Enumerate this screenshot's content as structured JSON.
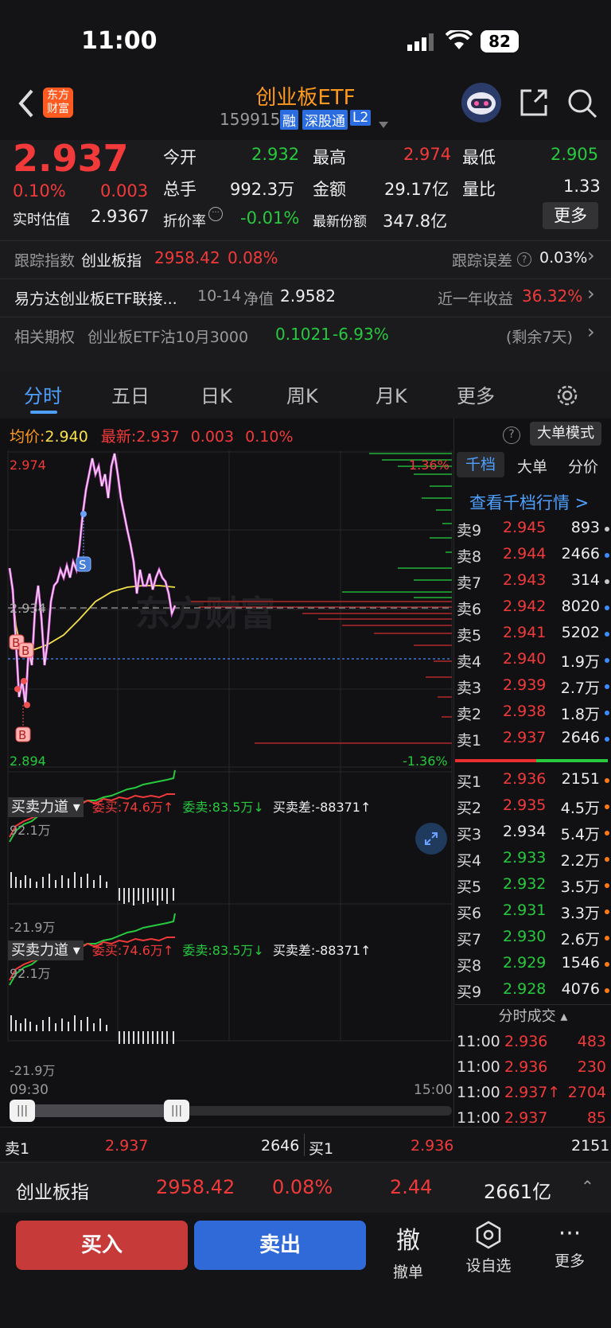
{
  "status": {
    "time": "11:00",
    "battery": "82"
  },
  "header": {
    "title": "创业板ETF",
    "code": "159915",
    "tags": [
      "融",
      "深股通",
      "L2"
    ],
    "logo_text_1": "东方",
    "logo_text_2": "财富"
  },
  "quote": {
    "price": "2.937",
    "change_pct": "0.10%",
    "change": "0.003",
    "est_label": "实时估值",
    "est_value": "2.9367",
    "open_label": "今开",
    "open": "2.932",
    "high_label": "最高",
    "high": "2.974",
    "low_label": "最低",
    "low": "2.905",
    "vol_label": "总手",
    "vol": "992.3万",
    "amount_label": "金额",
    "amount": "29.17亿",
    "ratio_label": "量比",
    "ratio": "1.33",
    "discount_label": "折价率",
    "discount": "-0.01%",
    "shares_label": "最新份额",
    "shares": "347.8亿",
    "more": "更多"
  },
  "track": {
    "label": "跟踪指数",
    "index": "创业板指",
    "value": "2958.42",
    "pct": "0.08%",
    "err_label": "跟踪误差",
    "err": "0.03%"
  },
  "fund": {
    "name": "易方达创业板ETF联接...",
    "date": "10-14",
    "nav_label": "净值",
    "nav": "2.9582",
    "ret_label": "近一年收益",
    "ret": "36.32%"
  },
  "option": {
    "label": "相关期权",
    "name": "创业板ETF沽10月3000",
    "price": "0.1021",
    "pct": "-6.93%",
    "remain": "(剩余7天)"
  },
  "tabs": [
    "分时",
    "五日",
    "日K",
    "周K",
    "月K",
    "更多"
  ],
  "chart": {
    "avg_label": "均价:",
    "avg": "2.940",
    "last_label": "最新:",
    "last": "2.937",
    "chg": "0.003",
    "pct": "0.10%",
    "big_mode": "大单模式",
    "high": "2.974",
    "low": "2.894",
    "mid": "2.934",
    "up_pct": "1.36%",
    "down_pct": "-1.36%",
    "time_start": "09:30",
    "time_end": "15:00",
    "watermark": "东方财富",
    "markers": [
      "B",
      "B",
      "B",
      "S"
    ]
  },
  "indicator": {
    "name": "买卖力道",
    "buy": "委买:74.6万",
    "sell": "委卖:83.5万",
    "diff": "买卖差:-88371",
    "max": "92.1万",
    "min": "-21.9万"
  },
  "book": {
    "tabs": [
      "千档",
      "大单",
      "分价"
    ],
    "link": "查看千档行情 >",
    "asks": [
      {
        "label": "卖9",
        "price": "2.945",
        "vol": "893",
        "dot": "#c8c8c8"
      },
      {
        "label": "卖8",
        "price": "2.944",
        "vol": "2466",
        "dot": "#3f8cff"
      },
      {
        "label": "卖7",
        "price": "2.943",
        "vol": "314",
        "dot": "#c8c8c8"
      },
      {
        "label": "卖6",
        "price": "2.942",
        "vol": "8020",
        "dot": "#3f8cff"
      },
      {
        "label": "卖5",
        "price": "2.941",
        "vol": "5202",
        "dot": "#3f8cff"
      },
      {
        "label": "卖4",
        "price": "2.940",
        "vol": "1.9万",
        "dot": "#3f8cff"
      },
      {
        "label": "卖3",
        "price": "2.939",
        "vol": "2.7万",
        "dot": "#3f8cff"
      },
      {
        "label": "卖2",
        "price": "2.938",
        "vol": "1.8万",
        "dot": "#3f8cff"
      },
      {
        "label": "卖1",
        "price": "2.937",
        "vol": "2646",
        "dot": "#3f8cff"
      }
    ],
    "bids": [
      {
        "label": "买1",
        "price": "2.936",
        "vol": "2151",
        "color": "red",
        "dot": "#ff7a1a"
      },
      {
        "label": "买2",
        "price": "2.935",
        "vol": "4.5万",
        "color": "red",
        "dot": "#ff7a1a"
      },
      {
        "label": "买3",
        "price": "2.934",
        "vol": "5.4万",
        "color": "white",
        "dot": "#ff7a1a"
      },
      {
        "label": "买4",
        "price": "2.933",
        "vol": "2.2万",
        "color": "green",
        "dot": "#ff7a1a"
      },
      {
        "label": "买5",
        "price": "2.932",
        "vol": "3.5万",
        "color": "green",
        "dot": "#ff7a1a"
      },
      {
        "label": "买6",
        "price": "2.931",
        "vol": "3.3万",
        "color": "green",
        "dot": "#ff7a1a"
      },
      {
        "label": "买7",
        "price": "2.930",
        "vol": "2.6万",
        "color": "green",
        "dot": "#ff7a1a"
      },
      {
        "label": "买8",
        "price": "2.929",
        "vol": "1546",
        "color": "green",
        "dot": "#ff7a1a"
      },
      {
        "label": "买9",
        "price": "2.928",
        "vol": "4076",
        "color": "green",
        "dot": "#ff7a1a"
      }
    ],
    "ticks_label": "分时成交",
    "ticks": [
      {
        "time": "11:00",
        "price": "2.936",
        "vol": "483"
      },
      {
        "time": "11:00",
        "price": "2.936",
        "vol": "230"
      },
      {
        "time": "11:00",
        "price": "2.937↑",
        "vol": "2704"
      },
      {
        "time": "11:00",
        "price": "2.937",
        "vol": "85"
      }
    ]
  },
  "level1": {
    "sell_label": "卖1",
    "sell_price": "2.937",
    "sell_vol": "2646",
    "buy_label": "买1",
    "buy_price": "2.936",
    "buy_vol": "2151"
  },
  "index_bar": {
    "name": "创业板指",
    "value": "2958.42",
    "pct": "0.08%",
    "chg": "2.44",
    "amount": "2661亿"
  },
  "actions": {
    "buy": "买入",
    "sell": "卖出",
    "cancel_icon": "撤",
    "cancel": "撤单",
    "watch": "设自选",
    "more": "更多"
  },
  "colors": {
    "up": "#f23a3a",
    "down": "#27c93f",
    "accent": "#ff9a1f",
    "blue": "#3f8cff"
  }
}
